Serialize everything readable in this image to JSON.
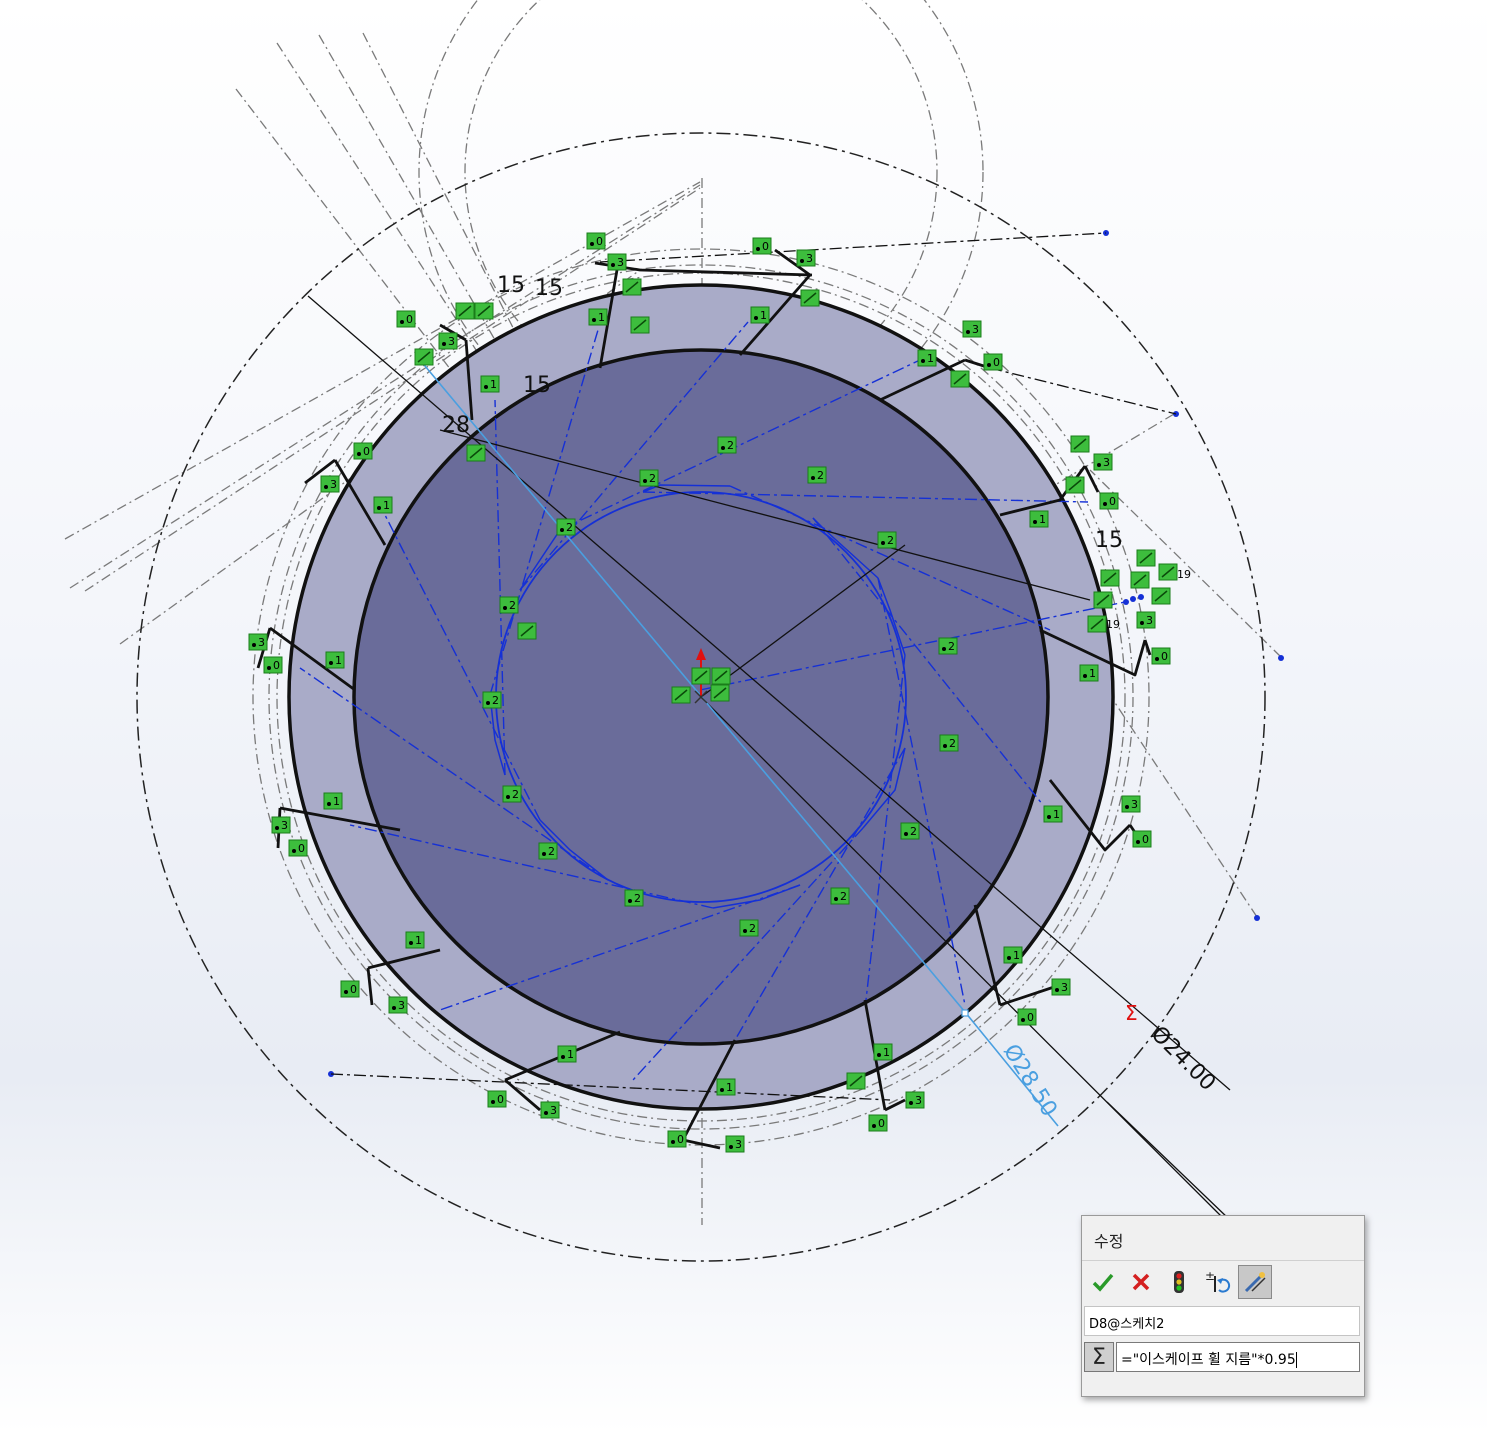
{
  "sketch": {
    "dimensions": {
      "dim_15_a": "15",
      "dim_15_b": "15",
      "dim_15_c": "15",
      "dim_15_d": "15",
      "dim_28": "28",
      "dia_24": "Ø24.00",
      "dia_28_50": "Ø28.50",
      "sigma_marker": "Σ",
      "equal_19_a": "19",
      "equal_19_b": "19"
    },
    "relation_labels": [
      "0",
      "1",
      "2",
      "3"
    ],
    "colors": {
      "outer_disc": "#a9abc8",
      "inner_disc": "#6a6c9a",
      "sketch_line": "#111111",
      "construction": "#888888",
      "blue_geometry": "#1530d6",
      "selected_dimension": "#4a9fe0",
      "relation_badge": "#3dbd3d",
      "origin_arrow": "#e01010"
    }
  },
  "modify_dialog": {
    "title": "수정",
    "buttons": {
      "ok": "check-icon",
      "cancel": "x-icon",
      "rebuild": "traffic-light-icon",
      "reverse": "reverse-dimension-icon",
      "mark_for_drawing": "mark-dimension-icon"
    },
    "dimension_name": "D8@스케치2",
    "equation_sign": "Σ",
    "equation_value": "=\"이스케이프 휠 지름\"*0.95"
  }
}
